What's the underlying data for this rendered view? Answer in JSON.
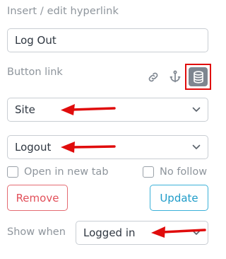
{
  "panel": {
    "title": "Insert / edit hyperlink",
    "link_text_value": "Log Out",
    "link_text_placeholder": "",
    "button_link_label": "Button link",
    "link_type_icons": [
      "link-icon",
      "anchor-icon",
      "database-icon"
    ],
    "active_link_type": "database-icon",
    "source_select": {
      "value": "Site"
    },
    "page_select": {
      "value": "Logout"
    },
    "open_new_tab": {
      "label": "Open in new tab",
      "checked": false
    },
    "no_follow": {
      "label": "No follow",
      "checked": false
    },
    "remove_label": "Remove",
    "update_label": "Update",
    "show_when_label": "Show when",
    "show_when_select": {
      "value": "Logged in"
    }
  },
  "annotations": {
    "highlight_color": "#e00c0c",
    "arrow_color": "#e00c0c"
  },
  "colors": {
    "remove": "#e2505a",
    "update": "#1f9cc9",
    "muted_text": "#8e959c",
    "active_icon_bg": "#7e8690"
  }
}
